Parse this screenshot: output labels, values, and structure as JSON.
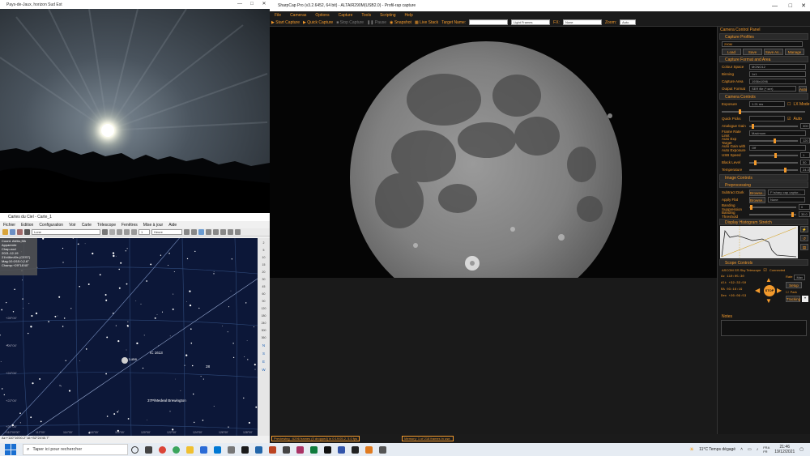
{
  "webcam_window": {
    "title": "Pays-de-Jaux, horizon Sud Est",
    "controls": [
      "—",
      "□",
      "✕"
    ]
  },
  "cdc_window": {
    "title": "Cartes du Ciel - Carte_1",
    "menus": [
      "Fichier",
      "Edition",
      "Configuration",
      "Voir",
      "Carte",
      "Télescope",
      "Fenêtres",
      "Mise à jour",
      "Aide"
    ],
    "search_value": "Lune",
    "step_value": "1",
    "unit_value": "Heure",
    "info_lines": [
      "Coord. Alt/Az 5th",
      "Apparente",
      "Chap-nod",
      "2021-12-19",
      "21h46m40s (CEST)",
      "Mag:10.0/15.0,2.6°",
      "Champ:+29°18'40\""
    ],
    "labels": {
      "moon": "Lune",
      "ic": "IC 1613",
      "comet": "37P/Medeal Brewington",
      "m31": "28"
    },
    "dec_ticks": [
      "+28°00'",
      "+26°00'",
      "+24°00'",
      "+22°00'",
      "+20°00'"
    ],
    "ra_ticks": [
      "+110°00'00\"",
      "112°00'",
      "114°00'",
      "116°00'",
      "118°00'",
      "120°00'",
      "122°00'",
      "124°00'",
      "126°00'",
      "128°00'"
    ],
    "right_ticks": [
      "2",
      "5",
      "10",
      "15",
      "20",
      "30",
      "45",
      "60",
      "90",
      "120",
      "180",
      "240",
      "300",
      "360"
    ],
    "right_buttons": [
      "N",
      "S",
      "E",
      "W"
    ],
    "status": "Az:+110°16'00.2\" Al:+32°24'40.7\""
  },
  "sharpcap": {
    "title": "SharpCap Pro (v3.2.6452, 64 bit) - ALTAIR290M(USB2.0) - Profil-rap capture",
    "menus": [
      "File",
      "Cameras",
      "Options",
      "Capture",
      "Tools",
      "Scripting",
      "Help"
    ],
    "toolbar": {
      "start_capture": "Start Capture",
      "quick_capture": "Quick Capture",
      "stop_capture": "Stop Capture",
      "pause": "Pause",
      "snapshot": "Snapshot",
      "live_stack": "Live Stack",
      "target_name_label": "Target Name:",
      "light_frames": "Light Frames",
      "fx_label": "FX:",
      "fx_value": "None",
      "zoom_label": "Zoom:",
      "zoom_value": "Auto"
    },
    "panel_title": "Camera Control Panel",
    "capture_profiles": {
      "header": "Capture Profiles",
      "value": "290M",
      "buttons": [
        "Load",
        "Save",
        "Save As...",
        "Manage"
      ]
    },
    "format": {
      "header": "Capture Format and Area",
      "rows": [
        {
          "label": "Colour Space",
          "value": "MONO12"
        },
        {
          "label": "Binning",
          "value": "1x1"
        },
        {
          "label": "Capture Area",
          "value": "1936x1096"
        },
        {
          "label": "Output Format",
          "value": "SER file (*.ser)"
        }
      ],
      "auto_button": "Auto"
    },
    "camera_controls": {
      "header": "Camera Controls",
      "exposure_label": "Exposure",
      "exposure_value": "1.21 ms",
      "lx_mode": "LX Mode",
      "quick_picks": "Quick Picks",
      "auto": "Auto",
      "rows": [
        {
          "label": "Analogue Gain",
          "value": "300",
          "level": 0.05
        },
        {
          "label": "Frame Rate Limit",
          "value": "Maximum",
          "level": null
        },
        {
          "label": "Auto Exp Target",
          "value": "120",
          "level": 0.5
        },
        {
          "label": "Auto Gain with Auto Exposure",
          "value": "Off",
          "level": null
        },
        {
          "label": "USB Speed",
          "value": "1",
          "level": 0.52
        },
        {
          "label": "Black Level",
          "value": "50",
          "level": 0.1
        },
        {
          "label": "Temperature",
          "value": "24.3",
          "level": 0.72
        }
      ]
    },
    "image_controls": {
      "header": "Image Controls"
    },
    "preprocessing": {
      "header": "Preprocessing",
      "rows": [
        {
          "label": "Subtract Dark",
          "button": "Browse...",
          "value": "F:\\sharp cap captur..."
        },
        {
          "label": "Apply Flat",
          "button": "Browse...",
          "value": "None"
        }
      ],
      "banding_suppression": {
        "label": "Banding Suppression",
        "value": "0"
      },
      "banding_threshold": {
        "label": "Banding Threshold",
        "value": "35.0"
      }
    },
    "histogram": {
      "header": "Display Histogram Stretch"
    },
    "scope": {
      "header": "Scope Controls",
      "driver": "ASCOM GS Sky Telescope",
      "connected": "Connected",
      "coords": [
        {
          "k": "Az",
          "v": "110:05:30"
        },
        {
          "k": "Alt",
          "v": "+32:33:50"
        },
        {
          "k": "RA",
          "v": "03:16:19"
        },
        {
          "k": "Dec",
          "v": "+26:09:53"
        }
      ],
      "rate_label": "Rate",
      "rate_value": "Max",
      "setup": "Setup",
      "park": "Park",
      "tracking": "Tracking",
      "stop": "STOP",
      "notes_label": "Notes"
    },
    "status_left": "Previewing : 6296 frames (0 dropped) in 0:19:05.2, 5.0 fps",
    "status_right": "Memory: 1 of 218 frames in use."
  },
  "taskbar": {
    "search_placeholder": "Taper ici pour rechercher",
    "weather": "11°C  Temps dégagé",
    "lang": "FRA\nFR",
    "time": "21:46",
    "date": "19/12/2021"
  }
}
